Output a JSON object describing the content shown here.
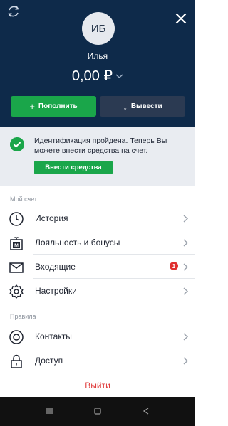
{
  "header": {
    "avatar_initials": "ИБ",
    "username": "Илья",
    "balance": "0,00 ₽",
    "topup_label": "Пополнить",
    "withdraw_label": "Вывести"
  },
  "notice": {
    "text": "Идентификация пройдена. Теперь Вы можете внести средства на счет.",
    "button_label": "Внести средства"
  },
  "sections": {
    "account_title": "Мой счет",
    "rules_title": "Правила"
  },
  "menu": {
    "history": "История",
    "loyalty": "Лояльность и бонусы",
    "inbox": "Входящие",
    "inbox_badge": "1",
    "settings": "Настройки",
    "contacts": "Контакты",
    "access": "Доступ"
  },
  "logout_label": "Выйти",
  "colors": {
    "header_bg": "#0e2a4a",
    "accent_green": "#1aa64a",
    "danger_red": "#e04040"
  }
}
